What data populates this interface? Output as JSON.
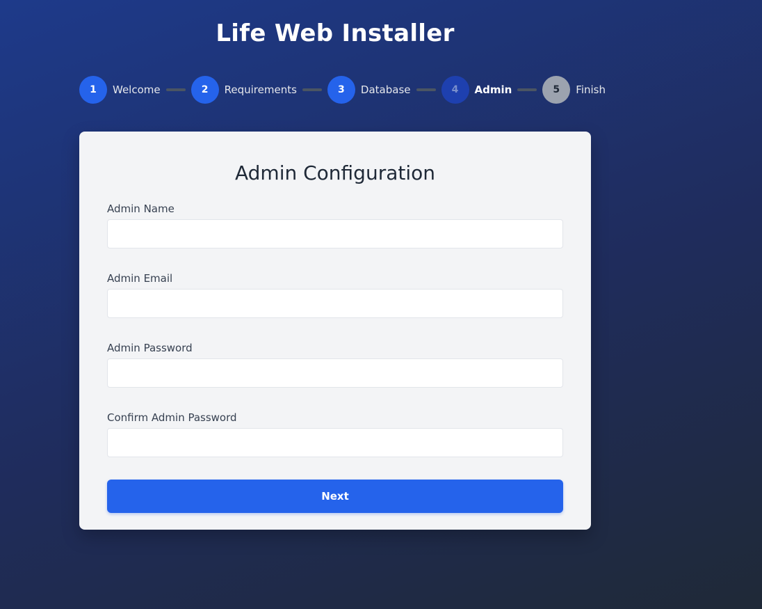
{
  "app": {
    "title": "Life Web Installer"
  },
  "steps": [
    {
      "number": "1",
      "label": "Welcome",
      "state": "complete"
    },
    {
      "number": "2",
      "label": "Requirements",
      "state": "complete"
    },
    {
      "number": "3",
      "label": "Database",
      "state": "complete"
    },
    {
      "number": "4",
      "label": "Admin",
      "state": "current"
    },
    {
      "number": "5",
      "label": "Finish",
      "state": "pending"
    }
  ],
  "form": {
    "title": "Admin Configuration",
    "fields": [
      {
        "label": "Admin Name",
        "value": "",
        "type": "text"
      },
      {
        "label": "Admin Email",
        "value": "",
        "type": "email"
      },
      {
        "label": "Admin Password",
        "value": "",
        "type": "password"
      },
      {
        "label": "Confirm Admin Password",
        "value": "",
        "type": "password"
      }
    ],
    "submit_label": "Next"
  },
  "colors": {
    "accent": "#2563eb",
    "current_step": "#1e40af",
    "pending_step": "#9ca3af",
    "card_background": "#f3f4f6"
  }
}
